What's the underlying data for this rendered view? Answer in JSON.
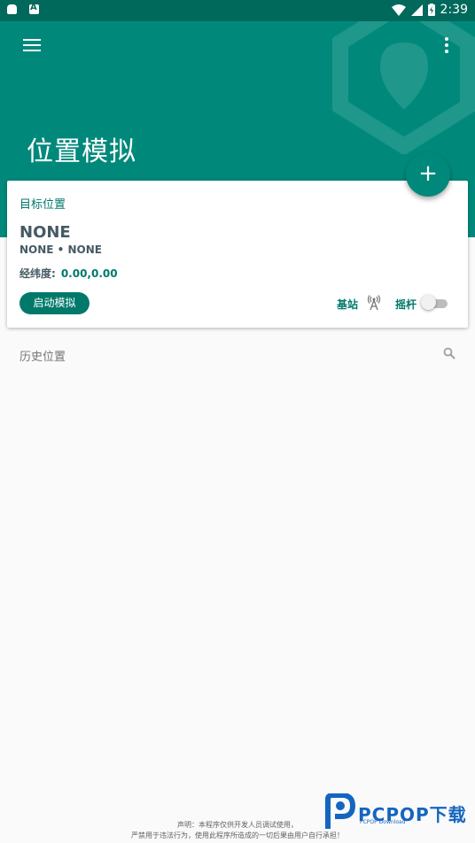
{
  "status_bar": {
    "time": "2:39"
  },
  "header": {
    "title": "位置模拟"
  },
  "card": {
    "label": "目标位置",
    "title": "NONE",
    "subtitle": "NONE • NONE",
    "coord_label": "经纬度:",
    "coord_value": "0.00,0.00",
    "start_button": "启动模拟",
    "base_station_label": "基站",
    "joystick_label": "摇杆",
    "joystick_on": false
  },
  "history": {
    "label": "历史位置"
  },
  "footer": {
    "line1": "声明：本程序仅供开发人员调试使用，",
    "line2": "严禁用于违法行为，使用此程序所造成的一切后果由用户自行承担！"
  },
  "watermark": {
    "text": "PCPOP下载",
    "sub": "PCPOP Download"
  },
  "colors": {
    "primary": "#00897b",
    "primary_dark": "#00695c",
    "accent": "#00796b"
  }
}
